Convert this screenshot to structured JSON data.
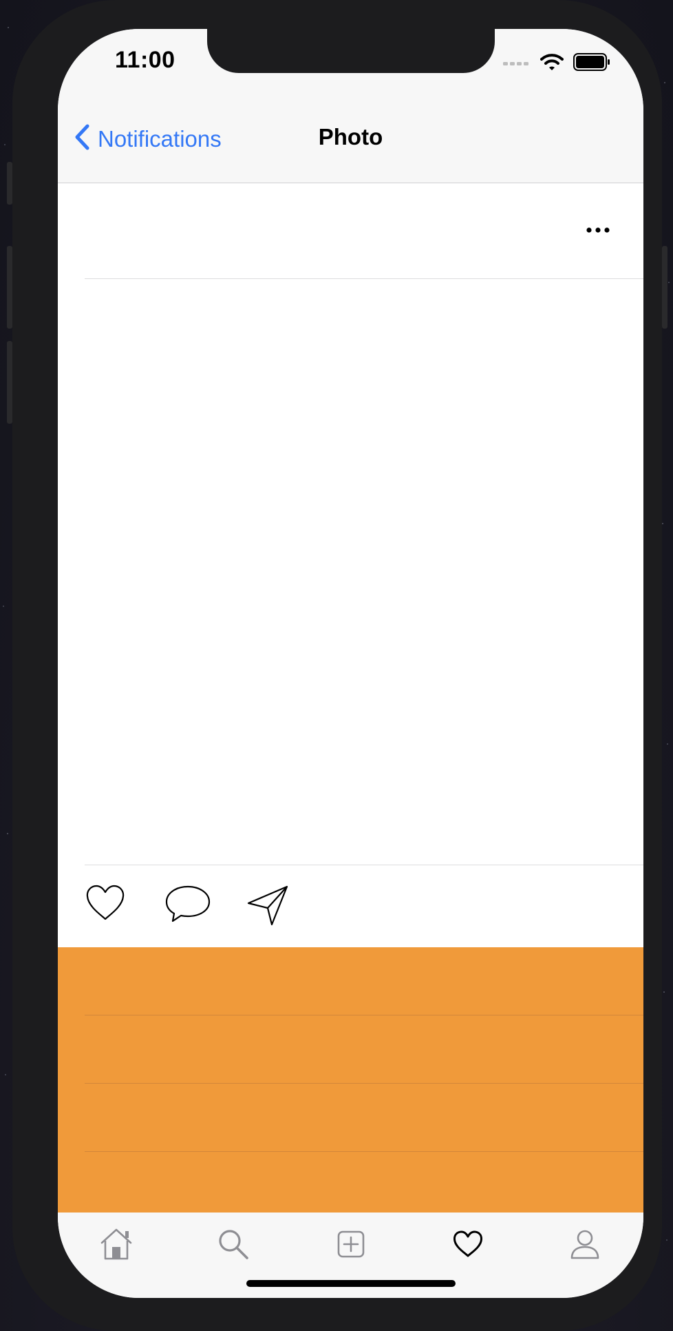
{
  "status_bar": {
    "time": "11:00",
    "icons": [
      "signal-icon",
      "wifi-icon",
      "battery-icon"
    ]
  },
  "nav": {
    "back_label": "Notifications",
    "title": "Photo"
  },
  "post": {
    "more_icon": "more-icon",
    "actions": [
      "like-icon",
      "comment-icon",
      "share-icon"
    ]
  },
  "tab_bar": {
    "items": [
      "home-icon",
      "search-icon",
      "add-icon",
      "activity-icon",
      "profile-icon"
    ],
    "selected": "activity-icon"
  },
  "colors": {
    "accent": "#3478f6",
    "highlight": "#f09a3a",
    "bar_background": "#f7f7f7"
  }
}
